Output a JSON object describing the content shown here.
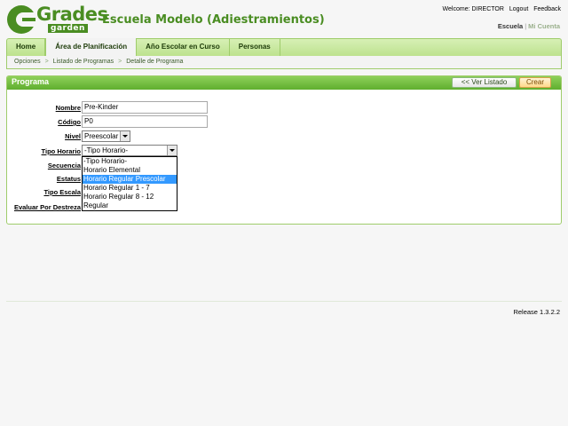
{
  "brand": {
    "logo_word": "Grades",
    "logo_sub": "garden",
    "school_name": "Escuela Modelo (Adiestramientos)"
  },
  "topbar": {
    "welcome": "Welcome: DIRECTOR",
    "logout": "Logout",
    "feedback": "Feedback"
  },
  "account": {
    "escuela": "Escuela",
    "separator": "|",
    "mi_cuenta": "Mi Cuenta"
  },
  "tabs": [
    {
      "label": "Home"
    },
    {
      "label": "Área de Planificación"
    },
    {
      "label": "Año Escolar en Curso"
    },
    {
      "label": "Personas"
    }
  ],
  "breadcrumb": [
    "Opciones",
    "Listado de Programas",
    "Detalle de Programa"
  ],
  "panel": {
    "title": "Programa",
    "back_button": "<< Ver Listado",
    "create_button": "Crear"
  },
  "form": {
    "nombre_label": "Nombre",
    "nombre_value": "Pre-Kinder",
    "codigo_label": "Código",
    "codigo_value": "P0",
    "nivel_label": "Nivel",
    "nivel_value": "Preescolar",
    "tipo_horario_label": "Tipo Horario",
    "tipo_horario_value": "-Tipo Horario-",
    "secuencia_label": "Secuencia",
    "estatus_label": "Estatus",
    "tipo_escala_label": "Tipo Escala",
    "evaluar_label": "Evaluar Por Destreza"
  },
  "tipo_horario_options": [
    "-Tipo Horario-",
    "Horario Elemental",
    "Horario Regular Prescolar",
    "Horario Regular 1 - 7",
    "Horario Regular 8 - 12",
    "Regular"
  ],
  "highlighted_option": "Horario Regular Prescolar",
  "footer": {
    "release": "Release 1.3.2.2"
  },
  "colors": {
    "brand_green": "#4a8d22",
    "tab_green": "#bde28e",
    "highlight_blue": "#3399ff"
  }
}
